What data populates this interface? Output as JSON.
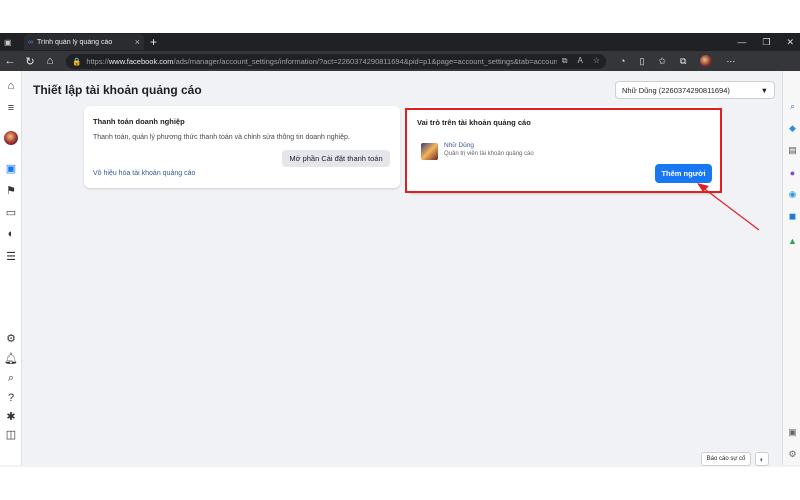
{
  "browser": {
    "tab_title": "Trình quản lý quảng cáo",
    "url_prefix": "https://",
    "url_domain": "www.facebook.com",
    "url_path": "/ads/manager/account_settings/information/?act=2260374290811694&pid=p1&page=account_settings&tab=account_information"
  },
  "page": {
    "title": "Thiết lập tài khoản quảng cáo",
    "account_select": "Nhữ Dũng (2260374290811694)"
  },
  "billing_card": {
    "heading": "Thanh toán doanh nghiệp",
    "description": "Thanh toán, quản lý phương thức thanh toán và chỉnh sửa thông tin doanh nghiệp.",
    "button": "Mở phần Cài đặt thanh toán",
    "deactivate_link": "Vô hiệu hóa tài khoản quảng cáo"
  },
  "roles_card": {
    "heading": "Vai trò trên tài khoản quảng cáo",
    "user_name": "Nhữ Dũng",
    "user_role": "Quản trị viên tài khoản quảng cáo",
    "add_button": "Thêm người"
  },
  "footer": {
    "report_button": "Báo cáo sự cố"
  },
  "colors": {
    "accent": "#1877f2",
    "highlight": "#e02020"
  }
}
